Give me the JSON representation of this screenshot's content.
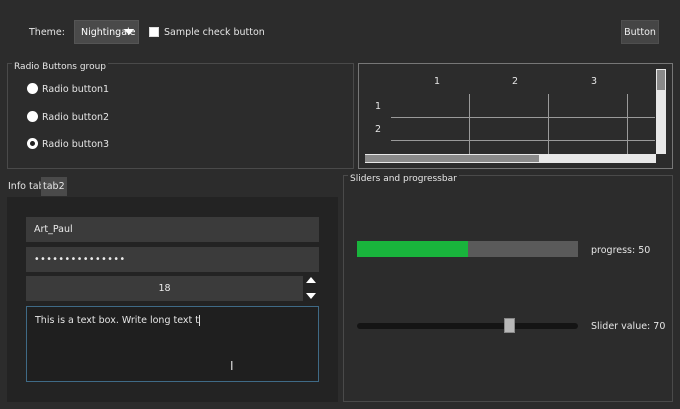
{
  "header": {
    "theme_label": "Theme:",
    "theme_value": "Nightingale",
    "check_label": "Sample check button",
    "button_label": "Button"
  },
  "radio_group": {
    "title": "Radio Buttons group",
    "items": [
      {
        "label": "Radio button1",
        "selected": false
      },
      {
        "label": "Radio button2",
        "selected": false
      },
      {
        "label": "Radio button3",
        "selected": true
      }
    ]
  },
  "table": {
    "columns": [
      "1",
      "2",
      "3"
    ],
    "rows": [
      "1",
      "2"
    ]
  },
  "tabs": {
    "items": [
      "Info tab",
      "tab2"
    ],
    "active": 1
  },
  "form": {
    "name_value": "Art_Paul",
    "password_value": "•••••••••••••••",
    "spin_value": "18",
    "textbox_value": "This is a text box. Write long text t"
  },
  "sliders": {
    "title": "Sliders and progressbar",
    "progress_label": "progress: 50",
    "progress_value": 50,
    "slider_label": "Slider value: 70",
    "slider_value": 70,
    "progress_color": "#19b43c"
  }
}
